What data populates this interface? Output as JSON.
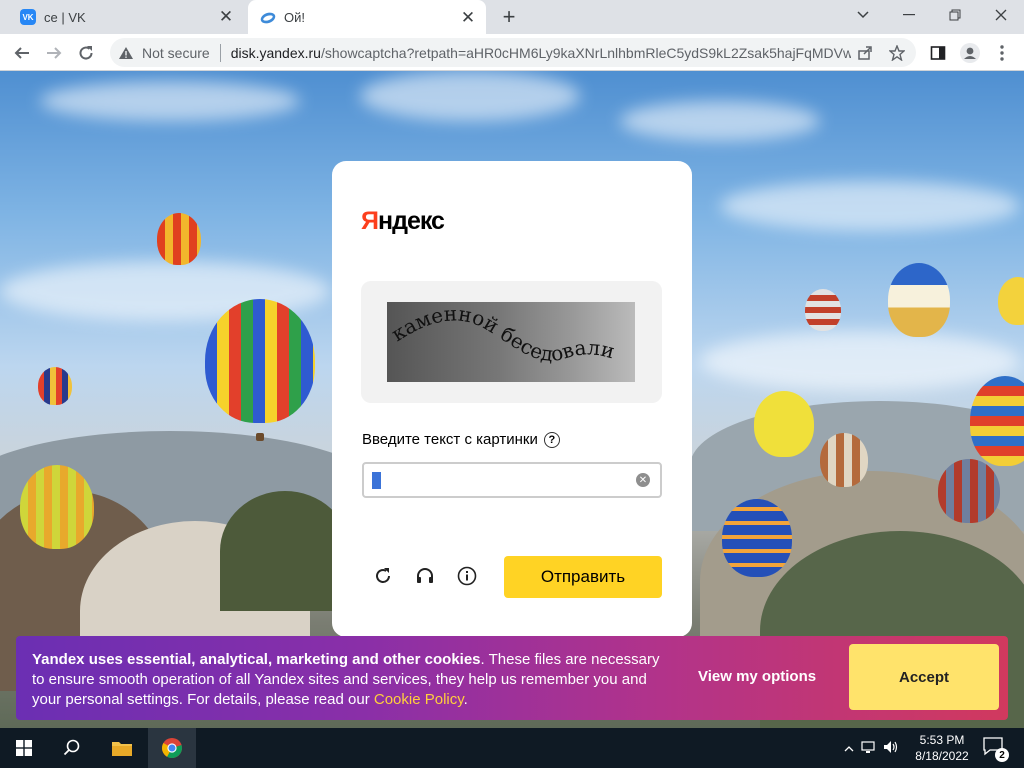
{
  "browser": {
    "tabs": [
      {
        "title": "ce | VK",
        "favicon": "vk-icon"
      },
      {
        "title": "Ой!",
        "favicon": "yandex-disk-icon"
      }
    ],
    "not_secure_label": "Not secure",
    "url_host": "disk.yandex.ru",
    "url_path": "/showcaptcha?retpath=aHR0cHM6Ly9kaXNrLnlhbmRleC5ydS9kL2Zsak5hajFqMDVw..."
  },
  "captcha": {
    "logo_first": "Я",
    "logo_rest": "ндекс",
    "image_text": "каменной беседовали",
    "prompt": "Введите текст с картинки",
    "help_label": "?",
    "input_value": "",
    "submit_label": "Отправить"
  },
  "cookie_banner": {
    "text_bold": "Yandex uses essential, analytical, marketing and other cookies",
    "text_body": ". These files are necessary to ensure smooth operation of all Yandex sites and services, they help us remember you and your personal settings. For details, please read our ",
    "policy_link": "Cookie Policy",
    "text_end": ".",
    "options_label": "View my options",
    "accept_label": "Accept"
  },
  "taskbar": {
    "time": "5:53 PM",
    "date": "8/18/2022",
    "notification_count": "2"
  },
  "colors": {
    "yandex_red": "#fc3f1d",
    "submit_yellow": "#ffd324",
    "accept_yellow": "#ffe36b",
    "link_yellow": "#ffcf3d"
  }
}
